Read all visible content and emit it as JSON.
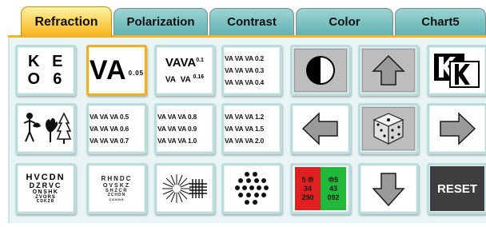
{
  "tabs": [
    {
      "label": "Refraction",
      "active": true
    },
    {
      "label": "Polarization",
      "active": false
    },
    {
      "label": "Contrast",
      "active": false
    },
    {
      "label": "Color",
      "active": false
    },
    {
      "label": "Chart5",
      "active": false
    }
  ],
  "colors": {
    "active_tab": "#f7b21c",
    "inactive_tab": "#5fb3b3",
    "button_border": "#b9dcdc",
    "selected_border": "#f2b01e",
    "reset_bg": "#3e3e3e"
  },
  "grid": {
    "letters": {
      "rows": [
        [
          "K",
          "E"
        ],
        [
          "O",
          "6"
        ]
      ]
    },
    "va_single": {
      "text": "VA",
      "value": "0.05"
    },
    "va_mixed": {
      "line1": [
        "VA",
        "VA",
        "0.1"
      ],
      "line2": [
        "VA",
        "VA",
        "0.16"
      ]
    },
    "va_lines_1": [
      "VA VA VA 0.2",
      "VA VA VA 0.3",
      "VA VA VA 0.4"
    ],
    "va_lines_2": [
      "VA VA VA 0.5",
      "VA VA VA 0.6",
      "VA VA VA 0.7"
    ],
    "va_lines_3": [
      "VA VA VA 0.8",
      "VA VA VA 0.9",
      "VA VA VA 1.0"
    ],
    "va_lines_4": [
      "VA VA VA 1.2",
      "VA VA VA 1.5",
      "VA VA VA 2.0"
    ],
    "hv_chart": [
      "HVCDN",
      "DZRVC",
      "ONSHK",
      "ZVORS",
      "CDKZR"
    ],
    "rh_chart": [
      "RHNDC",
      "OVSKZ",
      "SHZCR",
      "ZCHDN",
      "CDNNS"
    ],
    "red_green": {
      "red": [
        "5 ⦾",
        "34",
        "290"
      ],
      "green": [
        "⦾5",
        "43",
        "092"
      ]
    },
    "reset": {
      "label": "RESET"
    }
  },
  "icons": [
    "half-circle-icon",
    "arrow-up-icon",
    "k-overlay-icon",
    "figures-icon",
    "arrow-left-icon",
    "dice-icon",
    "arrow-right-icon",
    "sunburst-grid-icon",
    "dot-cluster-icon",
    "arrow-down-icon"
  ]
}
